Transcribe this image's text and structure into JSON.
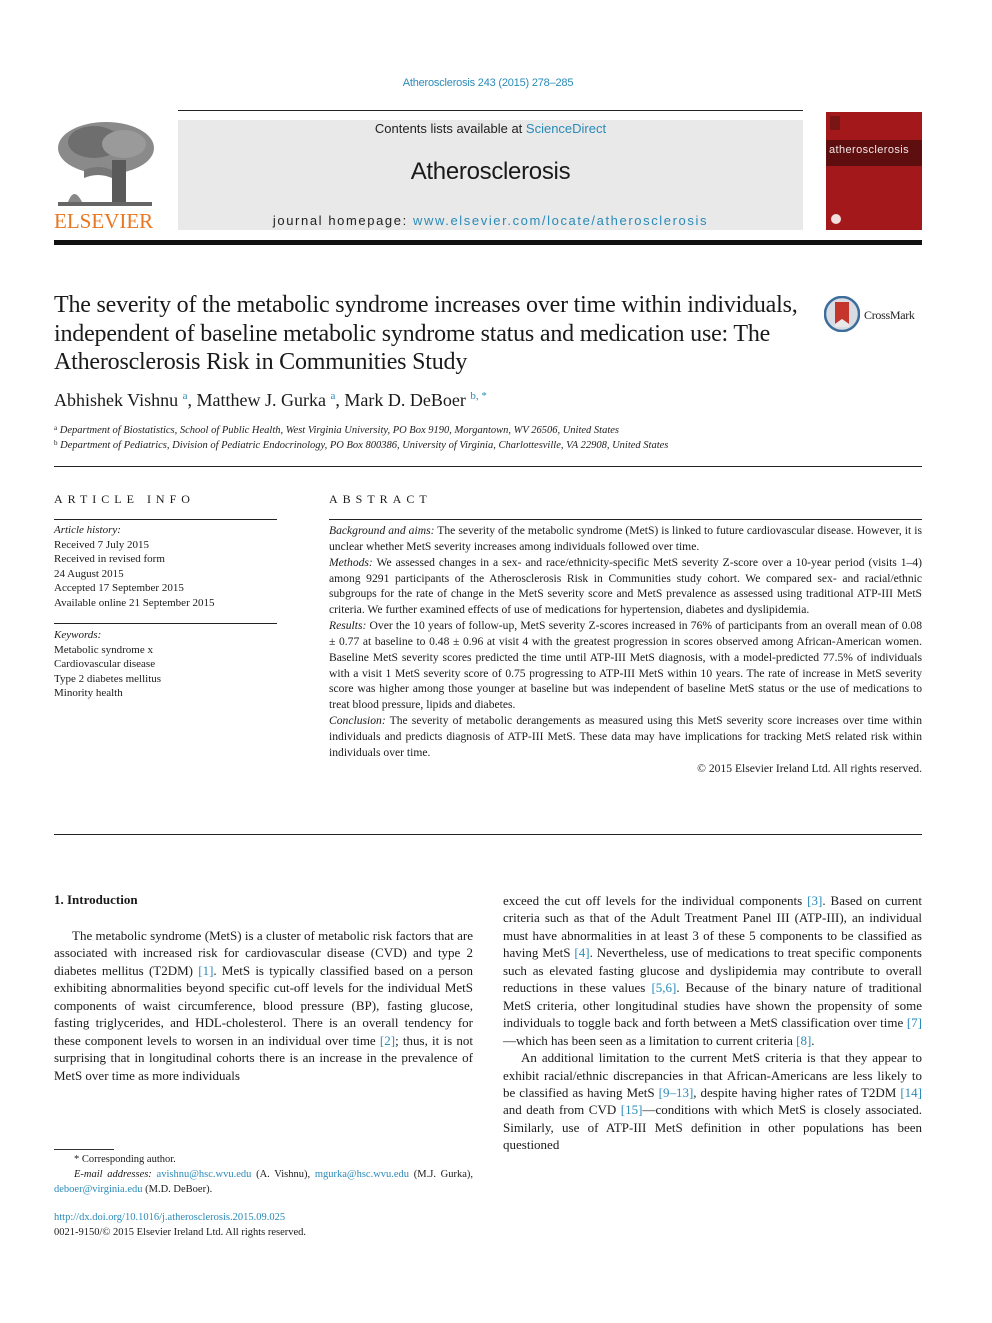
{
  "header": {
    "journal_ref": "Atherosclerosis 243 (2015) 278–285",
    "contents_prefix": "Contents lists available at ",
    "contents_link": "ScienceDirect",
    "journal_name": "Atherosclerosis",
    "homepage_prefix": "journal homepage: ",
    "homepage_link": "www.elsevier.com/locate/atherosclerosis",
    "publisher_logo_text": "ELSEVIER",
    "cover_title": "atherosclerosis",
    "colors": {
      "link": "#2a8ab8",
      "publisher_orange": "#e87722",
      "cover_red": "#a3191b",
      "masthead_gray": "#e9e9e9"
    }
  },
  "article": {
    "title": "The severity of the metabolic syndrome increases over time within individuals, independent of baseline metabolic syndrome status and medication use: The Atherosclerosis Risk in Communities Study",
    "crossmark_label": "CrossMark",
    "authors": [
      {
        "name": "Abhishek Vishnu",
        "sup": "a",
        "sep": ", "
      },
      {
        "name": "Matthew J. Gurka",
        "sup": "a",
        "sep": ", "
      },
      {
        "name": "Mark D. DeBoer",
        "sup": "b, *",
        "sep": ""
      }
    ],
    "affiliations": [
      {
        "key": "a",
        "text": "Department of Biostatistics, School of Public Health, West Virginia University, PO Box 9190, Morgantown, WV 26506, United States"
      },
      {
        "key": "b",
        "text": "Department of Pediatrics, Division of Pediatric Endocrinology, PO Box 800386, University of Virginia, Charlottesville, VA 22908, United States"
      }
    ]
  },
  "article_info": {
    "heading": "ARTICLE INFO",
    "history_label": "Article history:",
    "history": [
      "Received 7 July 2015",
      "Received in revised form",
      "24 August 2015",
      "Accepted 17 September 2015",
      "Available online 21 September 2015"
    ],
    "keywords_label": "Keywords:",
    "keywords": [
      "Metabolic syndrome x",
      "Cardiovascular disease",
      "Type 2 diabetes mellitus",
      "Minority health"
    ]
  },
  "abstract": {
    "heading": "ABSTRACT",
    "sections": [
      {
        "label": "Background and aims:",
        "text": " The severity of the metabolic syndrome (MetS) is linked to future cardiovascular disease. However, it is unclear whether MetS severity increases among individuals followed over time."
      },
      {
        "label": "Methods:",
        "text": " We assessed changes in a sex- and race/ethnicity-specific MetS severity Z-score over a 10-year period (visits 1–4) among 9291 participants of the Atherosclerosis Risk in Communities study cohort. We compared sex- and racial/ethnic subgroups for the rate of change in the MetS severity score and MetS prevalence as assessed using traditional ATP-III MetS criteria. We further examined effects of use of medications for hypertension, diabetes and dyslipidemia."
      },
      {
        "label": "Results:",
        "text": " Over the 10 years of follow-up, MetS severity Z-scores increased in 76% of participants from an overall mean of 0.08 ± 0.77 at baseline to 0.48 ± 0.96 at visit 4 with the greatest progression in scores observed among African-American women. Baseline MetS severity scores predicted the time until ATP-III MetS diagnosis, with a model-predicted 77.5% of individuals with a visit 1 MetS severity score of 0.75 progressing to ATP-III MetS within 10 years. The rate of increase in MetS severity score was higher among those younger at baseline but was independent of baseline MetS status or the use of medications to treat blood pressure, lipids and diabetes."
      },
      {
        "label": "Conclusion:",
        "text": " The severity of metabolic derangements as measured using this MetS severity score increases over time within individuals and predicts diagnosis of ATP-III MetS. These data may have implications for tracking MetS related risk within individuals over time."
      }
    ],
    "copyright": "© 2015 Elsevier Ireland Ltd. All rights reserved."
  },
  "introduction": {
    "heading": "1.  Introduction",
    "left_para": [
      {
        "t": "The metabolic syndrome (MetS) is a cluster of metabolic risk factors that are associated with increased risk for cardiovascular disease (CVD) and type 2 diabetes mellitus (T2DM) "
      },
      {
        "ref": "[1]"
      },
      {
        "t": ". MetS is typically classified based on a person exhibiting abnormalities beyond specific cut-off levels for the individual MetS components of waist circumference, blood pressure (BP), fasting glucose, fasting triglycerides, and HDL-cholesterol. There is an overall tendency for these component levels to worsen in an individual over time "
      },
      {
        "ref": "[2]"
      },
      {
        "t": "; thus, it is not surprising that in longitudinal cohorts there is an increase in the prevalence of MetS over time as more individuals"
      }
    ],
    "right_para_1": [
      {
        "t": "exceed the cut off levels for the individual components "
      },
      {
        "ref": "[3]"
      },
      {
        "t": ". Based on current criteria such as that of the Adult Treatment Panel III (ATP-III), an individual must have abnormalities in at least 3 of these 5 components to be classified as having MetS "
      },
      {
        "ref": "[4]"
      },
      {
        "t": ". Nevertheless, use of medications to treat specific components such as elevated fasting glucose and dyslipidemia may contribute to overall reductions in these values "
      },
      {
        "ref": "[5,6]"
      },
      {
        "t": ". Because of the binary nature of traditional MetS criteria, other longitudinal studies have shown the propensity of some individuals to toggle back and forth between a MetS classification over time "
      },
      {
        "ref": "[7]"
      },
      {
        "t": "—which has been seen as a limitation to current criteria "
      },
      {
        "ref": "[8]"
      },
      {
        "t": "."
      }
    ],
    "right_para_2": [
      {
        "t": "An additional limitation to the current MetS criteria is that they appear to exhibit racial/ethnic discrepancies in that African-Americans are less likely to be classified as having MetS "
      },
      {
        "ref": "[9–13]"
      },
      {
        "t": ", despite having higher rates of T2DM "
      },
      {
        "ref": "[14]"
      },
      {
        "t": " and death from CVD "
      },
      {
        "ref": "[15]"
      },
      {
        "t": "—conditions with which MetS is closely associated. Similarly, use of ATP-III MetS definition in other populations has been questioned"
      }
    ]
  },
  "footnotes": {
    "corresponding": "* Corresponding author.",
    "email_label": "E-mail addresses:",
    "emails": [
      {
        "email": "avishnu@hsc.wvu.edu",
        "who": " (A. Vishnu), "
      },
      {
        "email": "mgurka@hsc.wvu.edu",
        "who": " (M.J. Gurka), "
      },
      {
        "email": "deboer@virginia.edu",
        "who": " (M.D. DeBoer)."
      }
    ],
    "doi": "http://dx.doi.org/10.1016/j.atherosclerosis.2015.09.025",
    "issn_line": "0021-9150/© 2015 Elsevier Ireland Ltd. All rights reserved."
  }
}
